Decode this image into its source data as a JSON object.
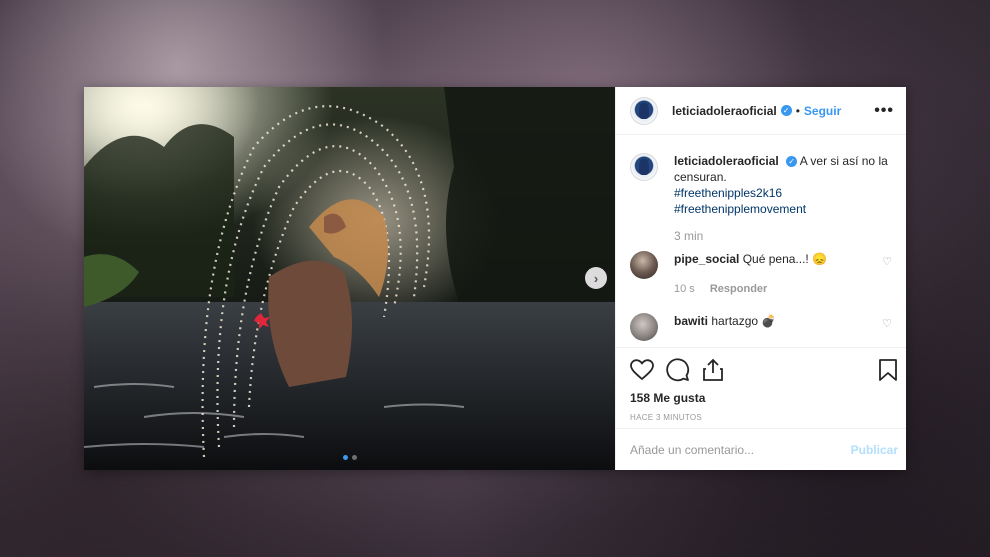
{
  "post": {
    "username": "leticiadoleraoficial",
    "follow_label": "Seguir",
    "separator": "•",
    "more_label": "•••",
    "caption_text": "A ver si así no la censuran.",
    "hashtags": [
      "#freethenipples2k16",
      "#freethenipplemovement"
    ],
    "caption_time": "3 min",
    "likes": "158 Me gusta",
    "timestamp": "HACE 3 MINUTOS"
  },
  "comments": [
    {
      "username": "pipe_social",
      "text": "Qué pena...! 😞",
      "time": "10 s",
      "reply_label": "Responder"
    },
    {
      "username": "bawiti",
      "text": "hartazgo 💣"
    }
  ],
  "composer": {
    "placeholder": "Añade un comentario...",
    "publish_label": "Publicar"
  },
  "carousel": {
    "current": 1,
    "total": 2
  },
  "colors": {
    "accent": "#3897f0",
    "hashtag": "#003569",
    "active_dot": "#3e99ee"
  },
  "icons": [
    "verified-icon",
    "heart-icon",
    "comment-icon",
    "share-icon",
    "bookmark-icon",
    "chevron-right-icon",
    "more-icon"
  ]
}
